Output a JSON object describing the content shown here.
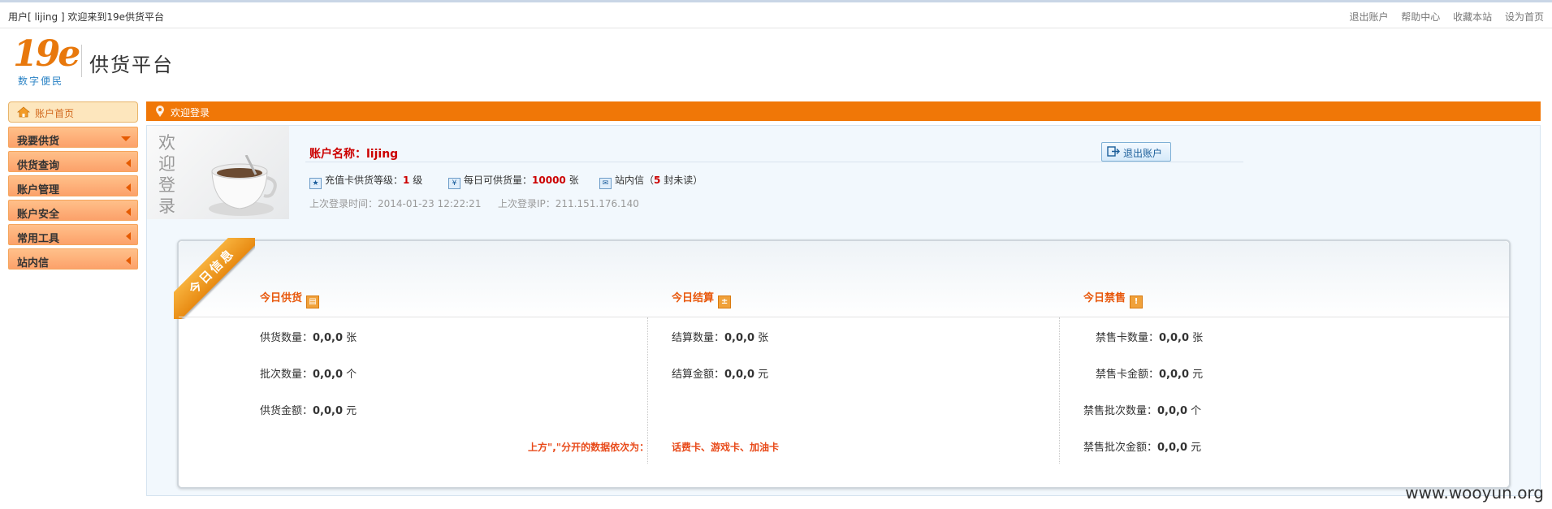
{
  "topbar": {
    "welcome": "用户[ lijing ] 欢迎来到19e供货平台",
    "links": [
      "退出账户",
      "帮助中心",
      "收藏本站",
      "设为首页"
    ]
  },
  "brand": {
    "logo_text": "19e",
    "logo_sub": "数字便民",
    "platform": "供货平台"
  },
  "sidebar": {
    "home": "账户首页",
    "items": [
      {
        "label": "我要供货",
        "expanded": true
      },
      {
        "label": "供货查询",
        "expanded": false
      },
      {
        "label": "账户管理",
        "expanded": false
      },
      {
        "label": "账户安全",
        "expanded": false
      },
      {
        "label": "常用工具",
        "expanded": false
      },
      {
        "label": "站内信",
        "expanded": false
      }
    ]
  },
  "main": {
    "title": "欢迎登录",
    "welcome_vertical": [
      "欢",
      "迎",
      "登",
      "录"
    ],
    "account_name": "账户名称：lijing",
    "logout_btn": "退出账户",
    "level_label": "充值卡供货等级：",
    "level_value": "1",
    "level_unit": " 级",
    "daily_label": "每日可供货量：",
    "daily_value": "10000",
    "daily_unit": " 张",
    "mail_label": "站内信（",
    "mail_value": "5",
    "mail_unit": " 封未读）",
    "last_time": "上次登录时间：2014-01-23 12:22:21",
    "last_ip": "上次登录IP：211.151.176.140"
  },
  "today": {
    "ribbon": "今日信息",
    "supply": {
      "title": "今日供货",
      "rows": [
        {
          "label": "供货数量：",
          "value": "0,0,0",
          "unit": " 张"
        },
        {
          "label": "批次数量：",
          "value": "0,0,0",
          "unit": " 个"
        },
        {
          "label": "供货金额：",
          "value": "0,0,0",
          "unit": " 元"
        }
      ],
      "note": "上方\",\"分开的数据依次为："
    },
    "settle": {
      "title": "今日结算",
      "rows": [
        {
          "label": "结算数量：",
          "value": "0,0,0",
          "unit": " 张"
        },
        {
          "label": "结算金额：",
          "value": "0,0,0",
          "unit": " 元"
        }
      ],
      "note": "话费卡、游戏卡、加油卡"
    },
    "ban": {
      "title": "今日禁售",
      "rows": [
        {
          "label": "禁售卡数量：",
          "value": "0,0,0",
          "unit": " 张"
        },
        {
          "label": "禁售卡金额：",
          "value": "0,0,0",
          "unit": " 元"
        },
        {
          "label": "禁售批次数量：",
          "value": "0,0,0",
          "unit": " 个"
        },
        {
          "label": "禁售批次金额：",
          "value": "0,0,0",
          "unit": " 元"
        }
      ]
    }
  },
  "watermark": "www.wooyun.org"
}
